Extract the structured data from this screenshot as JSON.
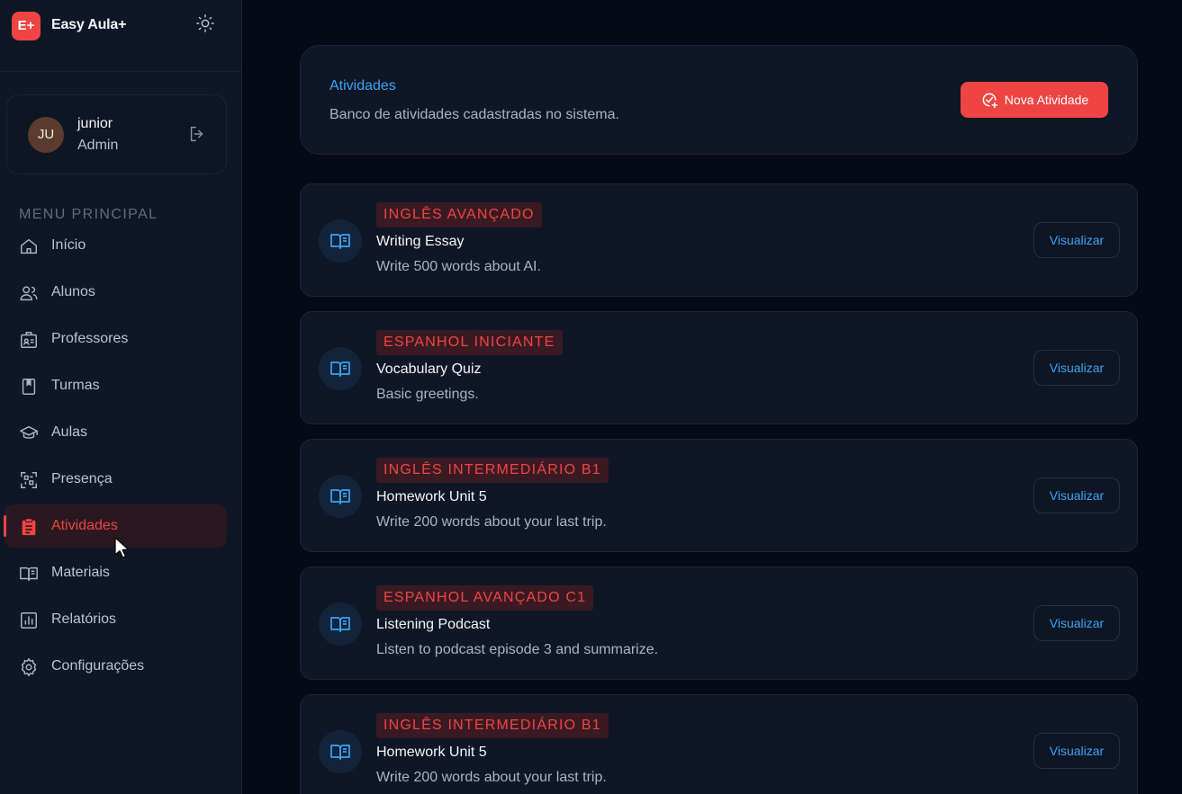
{
  "brand": {
    "logo_text": "E+",
    "name": "Easy Aula+",
    "theme_icon": "sun-icon"
  },
  "user": {
    "initials": "JU",
    "name": "junior",
    "role": "Admin",
    "logout_icon": "logout-icon"
  },
  "sidebar": {
    "menu_title": "MENU PRINCIPAL",
    "items": [
      {
        "label": "Início",
        "icon": "home-icon"
      },
      {
        "label": "Alunos",
        "icon": "users-icon"
      },
      {
        "label": "Professores",
        "icon": "id-card-icon"
      },
      {
        "label": "Turmas",
        "icon": "notebook-icon"
      },
      {
        "label": "Aulas",
        "icon": "graduation-cap-icon"
      },
      {
        "label": "Presença",
        "icon": "qr-code-icon"
      },
      {
        "label": "Atividades",
        "icon": "clipboard-icon",
        "active": true
      },
      {
        "label": "Materiais",
        "icon": "book-open-icon"
      },
      {
        "label": "Relatórios",
        "icon": "bar-chart-icon"
      },
      {
        "label": "Configurações",
        "icon": "gear-icon"
      }
    ]
  },
  "header": {
    "title": "Atividades",
    "subtitle": "Banco de atividades cadastradas no sistema.",
    "new_button": "Nova Atividade"
  },
  "activities": [
    {
      "tag": "INGLÊS AVANÇADO",
      "title": "Writing Essay",
      "description": "Write 500 words about AI.",
      "action": "Visualizar"
    },
    {
      "tag": "ESPANHOL INICIANTE",
      "title": "Vocabulary Quiz",
      "description": "Basic greetings.",
      "action": "Visualizar"
    },
    {
      "tag": "INGLÊS INTERMEDIÁRIO B1",
      "title": "Homework Unit 5",
      "description": "Write 200 words about your last trip.",
      "action": "Visualizar"
    },
    {
      "tag": "ESPANHOL AVANÇADO C1",
      "title": "Listening Podcast",
      "description": "Listen to podcast episode 3 and summarize.",
      "action": "Visualizar"
    },
    {
      "tag": "INGLÊS INTERMEDIÁRIO B1",
      "title": "Homework Unit 5",
      "description": "Write 200 words about your last trip.",
      "action": "Visualizar"
    }
  ],
  "colors": {
    "accent": "#ef4444",
    "link": "#3aa3f5",
    "background": "#050a16",
    "card": "#0f1726"
  }
}
